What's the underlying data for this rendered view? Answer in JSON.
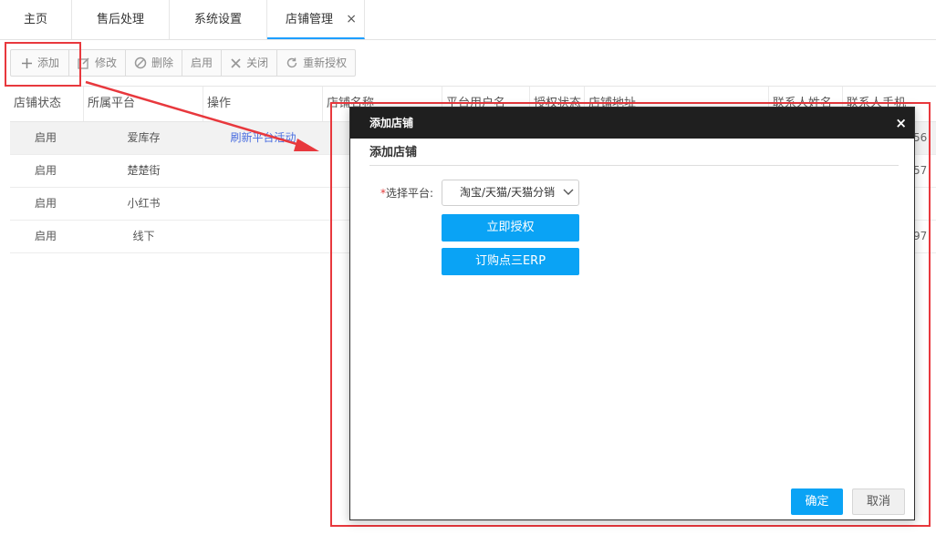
{
  "tabs": [
    {
      "label": "主页"
    },
    {
      "label": "售后处理"
    },
    {
      "label": "系统设置"
    },
    {
      "label": "店铺管理",
      "close": "×"
    }
  ],
  "toolbar": {
    "add": "添加",
    "edit": "修改",
    "delete": "删除",
    "enable": "启用",
    "close": "关闭",
    "reauth": "重新授权"
  },
  "table": {
    "headers": [
      "店铺状态",
      "所属平台",
      "操作",
      "店铺名称",
      "平台用户名",
      "授权状态",
      "店铺地址",
      "联系人姓名",
      "联系人手机"
    ],
    "rows": [
      {
        "status": "启用",
        "platform": "爱库存",
        "action": "刷新平台活动",
        "tail": "56"
      },
      {
        "status": "启用",
        "platform": "楚楚街",
        "action": "",
        "tail": "57"
      },
      {
        "status": "启用",
        "platform": "小红书",
        "action": "",
        "tail": ""
      },
      {
        "status": "启用",
        "platform": "线下",
        "action": "",
        "tail": "97"
      }
    ]
  },
  "modal": {
    "title": "添加店铺",
    "close": "×",
    "subtitle": "添加店铺",
    "platform_label_req": "*",
    "platform_label": "选择平台:",
    "platform_selected": "淘宝/天猫/天猫分销",
    "authorize_button": "立即授权",
    "order_button": "订购点三ERP",
    "ok_button": "确定",
    "cancel_button": "取消"
  },
  "colors": {
    "accent": "#0aa3f5",
    "annotation": "#e8383d",
    "tab_active": "#1e9fff"
  }
}
